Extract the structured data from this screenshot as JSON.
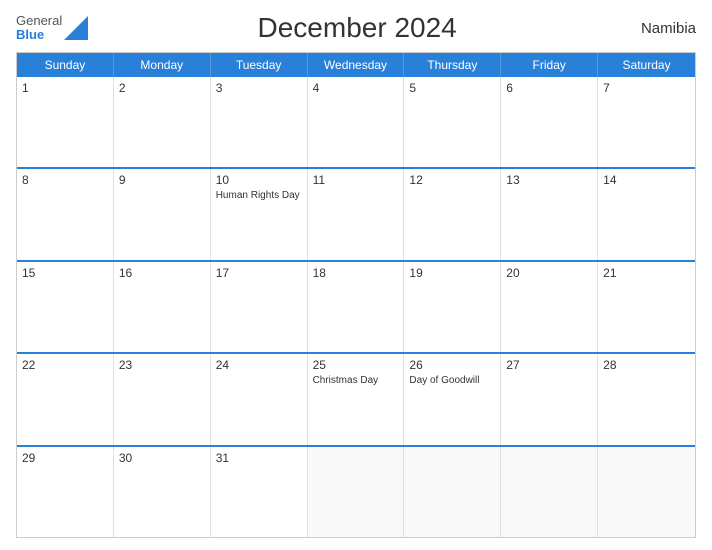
{
  "header": {
    "title": "December 2024",
    "country": "Namibia",
    "logo_line1": "General",
    "logo_line2": "Blue"
  },
  "days_of_week": [
    "Sunday",
    "Monday",
    "Tuesday",
    "Wednesday",
    "Thursday",
    "Friday",
    "Saturday"
  ],
  "weeks": [
    [
      {
        "date": "1",
        "event": ""
      },
      {
        "date": "2",
        "event": ""
      },
      {
        "date": "3",
        "event": ""
      },
      {
        "date": "4",
        "event": ""
      },
      {
        "date": "5",
        "event": ""
      },
      {
        "date": "6",
        "event": ""
      },
      {
        "date": "7",
        "event": ""
      }
    ],
    [
      {
        "date": "8",
        "event": ""
      },
      {
        "date": "9",
        "event": ""
      },
      {
        "date": "10",
        "event": "Human Rights Day"
      },
      {
        "date": "11",
        "event": ""
      },
      {
        "date": "12",
        "event": ""
      },
      {
        "date": "13",
        "event": ""
      },
      {
        "date": "14",
        "event": ""
      }
    ],
    [
      {
        "date": "15",
        "event": ""
      },
      {
        "date": "16",
        "event": ""
      },
      {
        "date": "17",
        "event": ""
      },
      {
        "date": "18",
        "event": ""
      },
      {
        "date": "19",
        "event": ""
      },
      {
        "date": "20",
        "event": ""
      },
      {
        "date": "21",
        "event": ""
      }
    ],
    [
      {
        "date": "22",
        "event": ""
      },
      {
        "date": "23",
        "event": ""
      },
      {
        "date": "24",
        "event": ""
      },
      {
        "date": "25",
        "event": "Christmas Day"
      },
      {
        "date": "26",
        "event": "Day of Goodwill"
      },
      {
        "date": "27",
        "event": ""
      },
      {
        "date": "28",
        "event": ""
      }
    ],
    [
      {
        "date": "29",
        "event": ""
      },
      {
        "date": "30",
        "event": ""
      },
      {
        "date": "31",
        "event": ""
      },
      {
        "date": "",
        "event": ""
      },
      {
        "date": "",
        "event": ""
      },
      {
        "date": "",
        "event": ""
      },
      {
        "date": "",
        "event": ""
      }
    ]
  ]
}
